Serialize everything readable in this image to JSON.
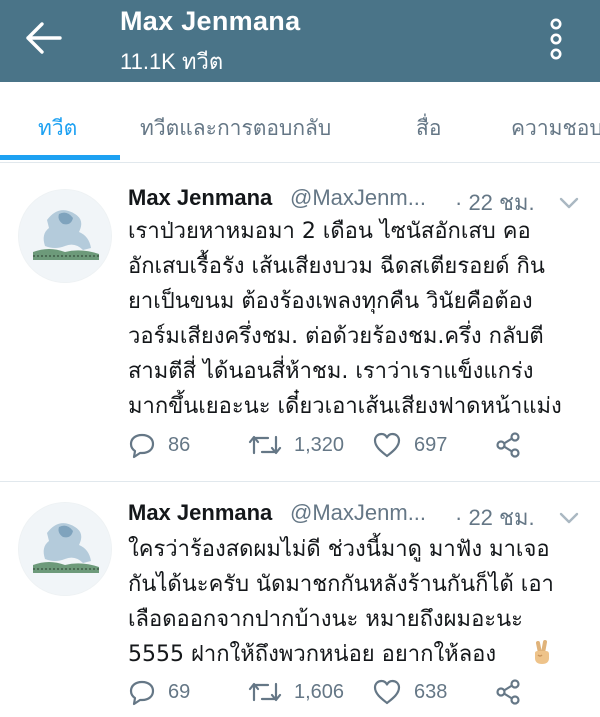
{
  "header": {
    "title": "Max Jenmana",
    "subtitle": "11.1K ทวีต"
  },
  "tabs": [
    {
      "label": "ทวีต",
      "active": true
    },
    {
      "label": "ทวีตและการตอบกลับ",
      "active": false
    },
    {
      "label": "สื่อ",
      "active": false
    },
    {
      "label": "ความชอบ",
      "active": false
    }
  ],
  "tweets": [
    {
      "name": "Max Jenmana",
      "handle": "@MaxJenm...",
      "time": "· 22 ชม.",
      "lines": [
        "เราป่วยหาหมอมา 2 เดือน ไซนัสอักเสบ คอ",
        "อักเสบเรื้อรัง เส้นเสียงบวม ฉีดสเตียรอยด์ กิน",
        "ยาเป็นขนม ต้องร้องเพลงทุกคืน วินัยคือต้อง",
        "วอร์มเสียงครึ่งชม. ต่อด้วยร้องชม.ครึ่ง กลับตี",
        "สามตีสี่ ได้นอนสี่ห้าชม. เราว่าเราแข็งแกร่ง",
        "มากขึ้นเยอะนะ เดี๋ยวเอาเส้นเสียงฟาดหน้าแม่ง"
      ],
      "replies": "86",
      "retweets": "1,320",
      "likes": "697"
    },
    {
      "name": "Max Jenmana",
      "handle": "@MaxJenm...",
      "time": "· 22 ชม.",
      "lines": [
        "ใครว่าร้องสดผมไม่ดี ช่วงนี้มาดู มาฟัง มาเจอ",
        "กันได้นะครับ นัดมาชกกันหลังร้านกันก็ได้ เอา",
        "เลือดออกจากปากบ้างนะ หมายถึงผมอะนะ",
        "5555 ฝากให้ถึงพวกหน่อย อยากให้ลอง"
      ],
      "replies": "69",
      "retweets": "1,606",
      "likes": "638"
    }
  ],
  "icons": {
    "back": "back-arrow-icon",
    "menu": "more-vertical-icon",
    "reply": "reply-icon",
    "retweet": "retweet-icon",
    "like": "heart-icon",
    "share": "share-icon",
    "emoji": "victory-hand-emoji"
  },
  "colors": {
    "header_bg": "#4a7488",
    "accent": "#1da1f2",
    "muted": "#657786",
    "text": "#14171a"
  }
}
